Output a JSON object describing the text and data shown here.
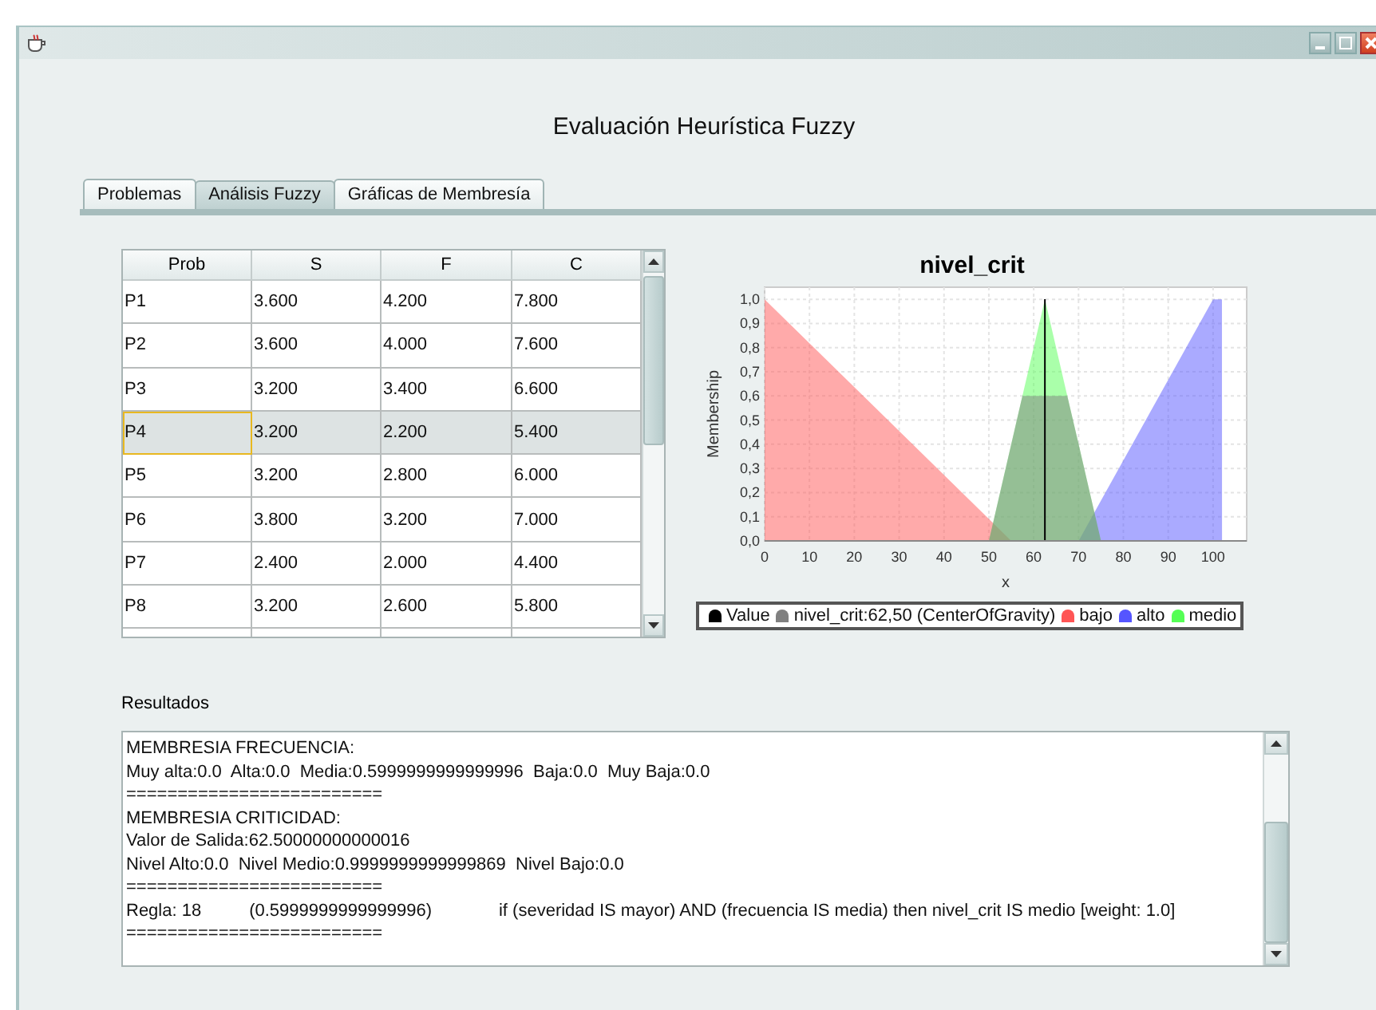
{
  "window": {
    "title": "Evaluación Heurística Fuzzy"
  },
  "tabs": [
    {
      "label": "Problemas",
      "selected": false
    },
    {
      "label": "Análisis Fuzzy",
      "selected": true
    },
    {
      "label": "Gráficas de Membresía",
      "selected": false
    }
  ],
  "table": {
    "columns": [
      "Prob",
      "S",
      "F",
      "C"
    ],
    "rows": [
      {
        "cells": [
          "P1",
          "3.600",
          "4.200",
          "7.800"
        ],
        "selected": false
      },
      {
        "cells": [
          "P2",
          "3.600",
          "4.000",
          "7.600"
        ],
        "selected": false
      },
      {
        "cells": [
          "P3",
          "3.200",
          "3.400",
          "6.600"
        ],
        "selected": false
      },
      {
        "cells": [
          "P4",
          "3.200",
          "2.200",
          "5.400"
        ],
        "selected": true
      },
      {
        "cells": [
          "P5",
          "3.200",
          "2.800",
          "6.000"
        ],
        "selected": false
      },
      {
        "cells": [
          "P6",
          "3.800",
          "3.200",
          "7.000"
        ],
        "selected": false
      },
      {
        "cells": [
          "P7",
          "2.400",
          "2.000",
          "4.400"
        ],
        "selected": false
      },
      {
        "cells": [
          "P8",
          "3.200",
          "2.600",
          "5.800"
        ],
        "selected": false
      }
    ]
  },
  "chart": {
    "chart_data": {
      "type": "area",
      "title": "nivel_crit",
      "xlabel": "x",
      "ylabel": "Membership",
      "x": [
        0,
        50,
        55,
        57.5,
        62.5,
        67.5,
        70,
        75,
        100,
        102
      ],
      "series": [
        {
          "name": "nivel_crit:62,50 (CenterOfGravity)",
          "color": "#808080",
          "values": [
            null,
            0,
            0.4,
            0.6,
            0.6,
            0.6,
            0.4,
            0,
            null,
            null
          ]
        },
        {
          "name": "bajo",
          "color": "#ff5555",
          "values": [
            1,
            0.091,
            0,
            null,
            null,
            null,
            null,
            null,
            null,
            null
          ]
        },
        {
          "name": "alto",
          "color": "#5555ff",
          "values": [
            null,
            null,
            null,
            null,
            null,
            null,
            0,
            0.167,
            1,
            1
          ]
        },
        {
          "name": "medio",
          "color": "#55ff55",
          "values": [
            null,
            0,
            0.4,
            0.6,
            1,
            0.6,
            0.4,
            0,
            null,
            null
          ]
        }
      ],
      "xlim": [
        0,
        107.5
      ],
      "ylim": [
        0,
        1.05
      ],
      "xticks": [
        0,
        10,
        20,
        30,
        40,
        50,
        60,
        70,
        80,
        90,
        100
      ],
      "yticks": [
        {
          "value": 0,
          "label": "0,0"
        },
        {
          "value": 0.1,
          "label": "0,1"
        },
        {
          "value": 0.2,
          "label": "0,2"
        },
        {
          "value": 0.3,
          "label": "0,3"
        },
        {
          "value": 0.4,
          "label": "0,4"
        },
        {
          "value": 0.5,
          "label": "0,5"
        },
        {
          "value": 0.6,
          "label": "0,6"
        },
        {
          "value": 0.7,
          "label": "0,7"
        },
        {
          "value": 0.8,
          "label": "0,8"
        },
        {
          "value": 0.9,
          "label": "0,9"
        },
        {
          "value": 1,
          "label": "1,0"
        }
      ],
      "grid": true,
      "ref_lines": [
        {
          "axis": "x",
          "value": 62.5,
          "label": "Value",
          "color": "#000000"
        }
      ]
    }
  },
  "results": {
    "label": "Resultados",
    "lines": [
      [
        "MEMBRESIA FRECUENCIA:"
      ],
      [
        "Muy alta:0.0  Alta:0.0  Media:0.5999999999999996  Baja:0.0  Muy Baja:0.0"
      ],
      [
        "========================="
      ],
      [
        "MEMBRESIA CRITICIDAD:"
      ],
      [
        "Valor de Salida:62.50000000000016"
      ],
      [
        "Nivel Alto:0.0  Nivel Medio:0.9999999999999869  Nivel Bajo:0.0"
      ],
      [
        "========================="
      ],
      [
        "Regla: 18",
        "(0.5999999999999996)",
        "if (severidad IS mayor) AND (frecuencia IS media) then nivel_crit IS medio [weight: 1.0]"
      ],
      [
        "========================="
      ]
    ]
  }
}
